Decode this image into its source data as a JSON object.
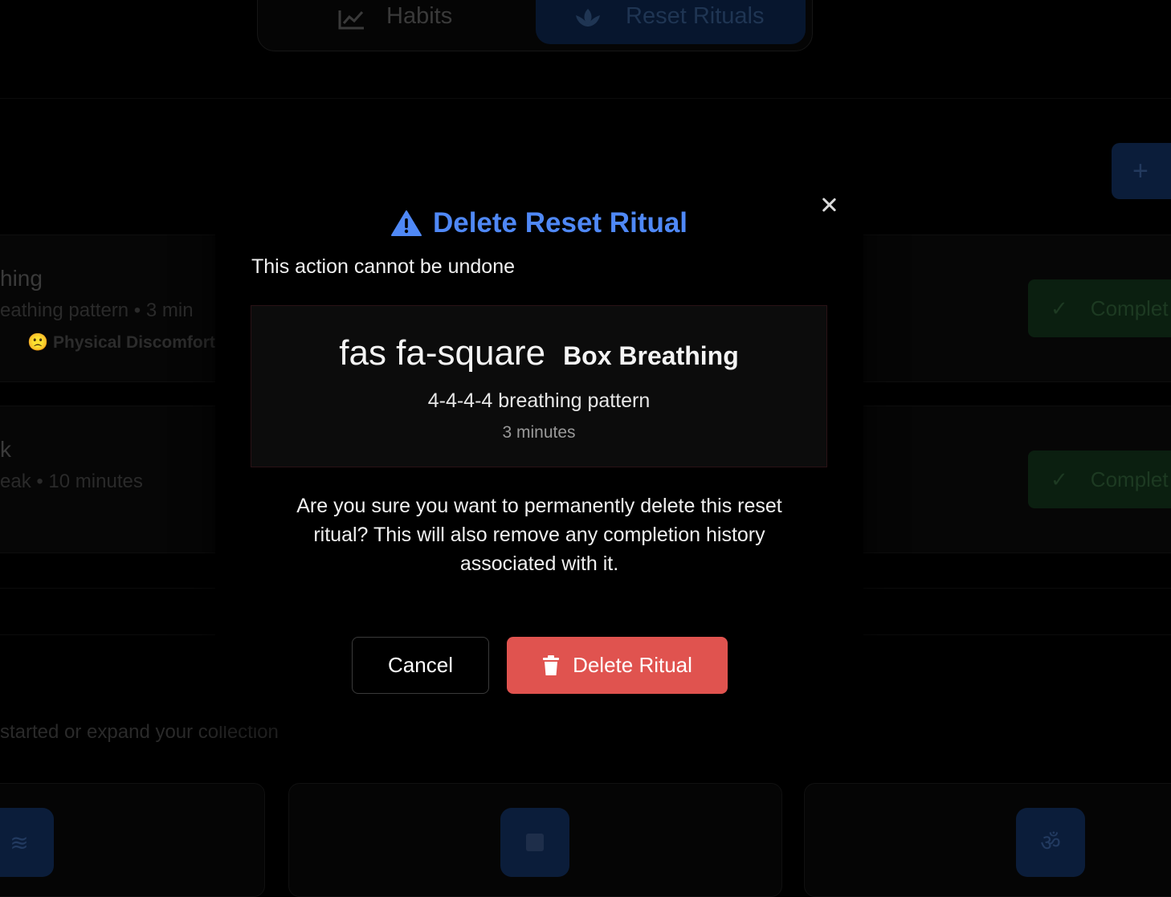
{
  "nav": {
    "tabs": [
      {
        "label": "Habits",
        "icon": "chart-line-icon"
      },
      {
        "label": "Reset Rituals",
        "icon": "lotus-icon"
      }
    ]
  },
  "background": {
    "add_button": "+",
    "rituals": [
      {
        "title": "hing",
        "subtitle": "eathing pattern • 3 min",
        "tag": "🙁 Physical Discomfort",
        "action": "Complet"
      },
      {
        "title": "k",
        "subtitle": "eak • 10 minutes",
        "action": "Complet"
      }
    ],
    "suggestions_text": "started or expand your collection",
    "template_icons": [
      "wind-icon",
      "square-icon",
      "om-icon"
    ]
  },
  "modal": {
    "title": "Delete Reset Ritual",
    "subtitle": "This action cannot be undone",
    "preview": {
      "icon_text": "fas fa-square",
      "name": "Box Breathing",
      "description": "4-4-4-4 breathing pattern",
      "duration": "3 minutes"
    },
    "confirm_text": "Are you sure you want to permanently delete this reset ritual? This will also remove any completion history associated with it.",
    "cancel_label": "Cancel",
    "delete_label": "Delete Ritual"
  },
  "colors": {
    "title_blue": "#4f88f6",
    "danger": "#e0534f",
    "background": "#000000"
  }
}
